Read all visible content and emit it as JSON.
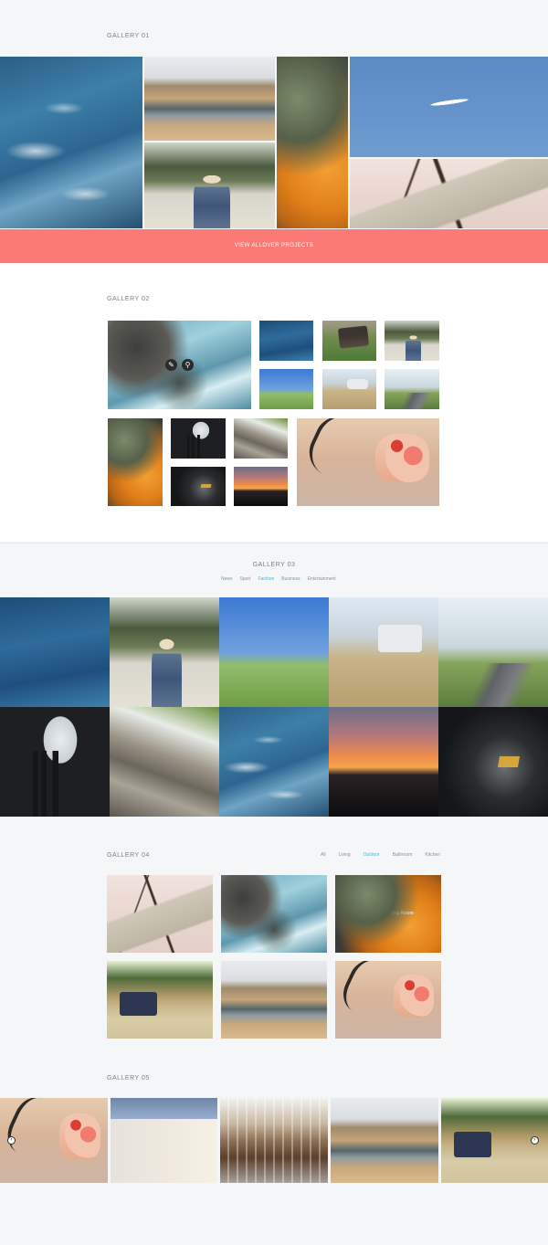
{
  "gallery01": {
    "title": "GALLERY 01",
    "cta_label": "VIEW ALLOVER PROJECTS",
    "cta_color": "#fb7a75"
  },
  "gallery02": {
    "title": "GALLERY 02",
    "overlay_icons": [
      "link-icon",
      "search-icon"
    ]
  },
  "gallery03": {
    "title": "GALLERY 03",
    "filters": [
      "News",
      "Sport",
      "Fashion",
      "Business",
      "Entertainment"
    ],
    "active_filter": "Fashion",
    "accent_color": "#4fb3d3"
  },
  "gallery04": {
    "title": "GALLERY 04",
    "filters": [
      "All",
      "Living",
      "Outdoor",
      "Bathroom",
      "Kitchen"
    ],
    "active_filter": "Outdoor",
    "hover_caption": "Modern Living Room"
  },
  "gallery05": {
    "title": "GALLERY 05",
    "nav_icons": [
      "arrow-left-icon",
      "arrow-right-icon"
    ]
  }
}
